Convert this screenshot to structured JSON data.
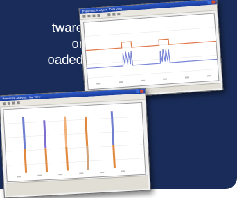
{
  "marketing": {
    "lines": [
      "tware",
      "or",
      "oaded"
    ]
  },
  "colors": {
    "panel_bg": "#1a2d5a",
    "window_titlebar": "#2c58c7",
    "trace_red": "#e07a4a",
    "trace_blue": "#7a86d6",
    "bar_blue": "#6f7fd0",
    "bar_orange": "#e0893e"
  },
  "windows": {
    "back": {
      "title": "Pneumatic Analyser - Data View"
    },
    "front": {
      "title": "Pneumatic Analyser - Bar View"
    }
  },
  "icons": {
    "titlebar_buttons": [
      "minimize-icon",
      "close-icon"
    ]
  }
}
